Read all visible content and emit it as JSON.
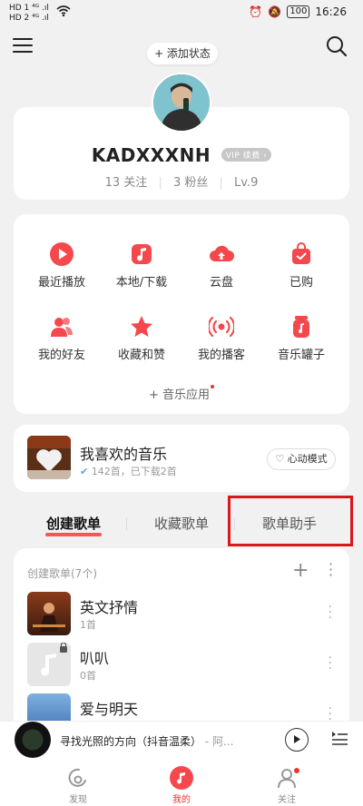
{
  "status_bar": {
    "left_line1": "HD 1 ⁴ᴳ .ıl",
    "left_line2": "HD 2 ⁴ᴳ .ıl",
    "battery": "100",
    "time": "16:26"
  },
  "header": {
    "add_status": "+ 添加状态"
  },
  "profile": {
    "username": "KADXXXNH",
    "vip_badge": "VIP 续费 ›",
    "following": "13 关注",
    "followers": "3 粉丝",
    "level": "Lv.9"
  },
  "quick_grid": {
    "items": [
      {
        "label": "最近播放",
        "icon": "play-icon"
      },
      {
        "label": "本地/下载",
        "icon": "music-note-icon"
      },
      {
        "label": "云盘",
        "icon": "cloud-upload-icon"
      },
      {
        "label": "已购",
        "icon": "shopping-bag-icon"
      },
      {
        "label": "我的好友",
        "icon": "friends-icon"
      },
      {
        "label": "收藏和赞",
        "icon": "star-icon"
      },
      {
        "label": "我的播客",
        "icon": "radio-icon"
      },
      {
        "label": "音乐罐子",
        "icon": "music-jar-icon"
      }
    ],
    "more_apps": "+ 音乐应用"
  },
  "liked": {
    "title": "我喜欢的音乐",
    "subtitle": "142首，已下载2首",
    "mode_button": "心动模式"
  },
  "tabs": [
    {
      "label": "创建歌单"
    },
    {
      "label": "收藏歌单"
    },
    {
      "label": "歌单助手"
    }
  ],
  "playlists": {
    "header": "创建歌单(7个)",
    "items": [
      {
        "name": "英文抒情",
        "count": "1首"
      },
      {
        "name": "叭叭",
        "count": "0首"
      },
      {
        "name": "爱与明天",
        "count": ""
      }
    ]
  },
  "player": {
    "title": "寻找光照的方向（抖音温柔）",
    "artist": " - 阿..."
  },
  "bottom_nav": [
    {
      "label": "发现"
    },
    {
      "label": "我的"
    },
    {
      "label": "关注"
    }
  ],
  "colors": {
    "accent": "#ff3a3a",
    "highlight_box": "#d9171f"
  }
}
